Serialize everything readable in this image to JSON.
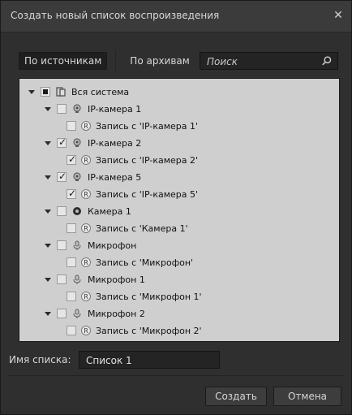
{
  "dialog": {
    "title": "Создать новый список воспроизведения"
  },
  "tabs": [
    {
      "label": "По источникам",
      "active": true
    },
    {
      "label": "По архивам",
      "active": false
    }
  ],
  "search": {
    "placeholder": "Поиск",
    "value": ""
  },
  "tree": {
    "root": {
      "label": "Вся система",
      "check": "partial",
      "expanded": true
    },
    "nodes": [
      {
        "label": "IP-камера 1",
        "check": "unchecked",
        "expanded": true,
        "icon": "ip-camera-icon",
        "child": {
          "label": "Запись с 'IP-камера 1'",
          "check": "unchecked"
        }
      },
      {
        "label": "IP-камера 2",
        "check": "checked",
        "expanded": true,
        "icon": "ip-camera-icon",
        "child": {
          "label": "Запись с 'IP-камера 2'",
          "check": "checked"
        }
      },
      {
        "label": "IP-камера 5",
        "check": "checked",
        "expanded": true,
        "icon": "ip-camera-icon",
        "child": {
          "label": "Запись с 'IP-камера 5'",
          "check": "checked"
        }
      },
      {
        "label": "Камера 1",
        "check": "unchecked",
        "expanded": true,
        "icon": "camera-icon",
        "child": {
          "label": "Запись с 'Камера 1'",
          "check": "unchecked"
        }
      },
      {
        "label": "Микрофон",
        "check": "unchecked",
        "expanded": true,
        "icon": "microphone-icon",
        "child": {
          "label": "Запись с 'Микрофон'",
          "check": "unchecked"
        }
      },
      {
        "label": "Микрофон 1",
        "check": "unchecked",
        "expanded": true,
        "icon": "microphone-icon",
        "child": {
          "label": "Запись с 'Микрофон 1'",
          "check": "unchecked"
        }
      },
      {
        "label": "Микрофон 2",
        "check": "unchecked",
        "expanded": true,
        "icon": "microphone-icon",
        "child": {
          "label": "Запись с 'Микрофон 2'",
          "check": "unchecked"
        }
      }
    ]
  },
  "list_name": {
    "label": "Имя списка:",
    "value": "Список 1"
  },
  "buttons": {
    "create": "Создать",
    "cancel": "Отмена"
  }
}
